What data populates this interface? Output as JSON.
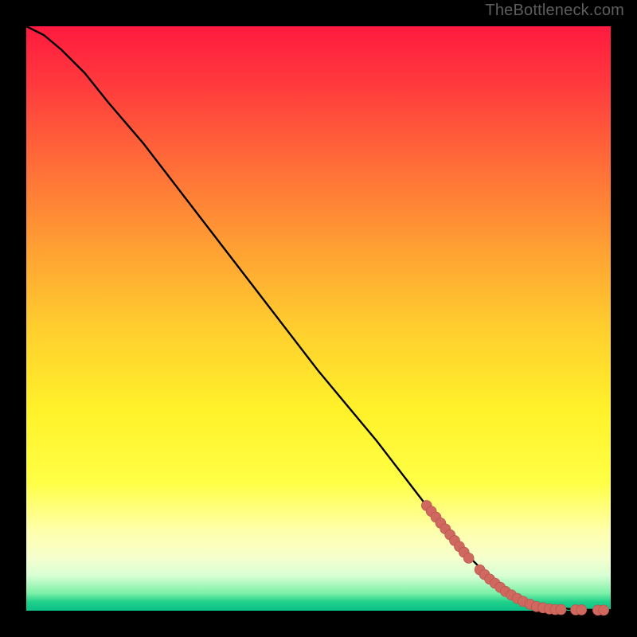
{
  "watermark": "TheBottleneck.com",
  "colors": {
    "background": "#000000",
    "watermark_text": "#5d5d5d",
    "curve_stroke": "#000000",
    "marker_fill": "#cf6960",
    "marker_stroke": "#b64f47"
  },
  "chart_data": {
    "type": "line",
    "title": "",
    "xlabel": "",
    "ylabel": "",
    "xlim": [
      0,
      100
    ],
    "ylim": [
      0,
      100
    ],
    "series": [
      {
        "name": "curve",
        "x": [
          0,
          3,
          6,
          10,
          14,
          20,
          30,
          40,
          50,
          60,
          70,
          76,
          80,
          83,
          85,
          87,
          90,
          94,
          100
        ],
        "y": [
          100,
          98.5,
          96,
          92,
          87,
          80,
          67,
          54,
          41,
          29,
          16,
          9,
          5,
          3,
          2,
          1.3,
          0.6,
          0.2,
          0.1
        ]
      }
    ],
    "markers": [
      {
        "x": 68.5,
        "y": 18.0
      },
      {
        "x": 69.3,
        "y": 17.0
      },
      {
        "x": 70.1,
        "y": 16.0
      },
      {
        "x": 70.9,
        "y": 15.0
      },
      {
        "x": 71.7,
        "y": 14.0
      },
      {
        "x": 72.5,
        "y": 13.0
      },
      {
        "x": 73.3,
        "y": 12.0
      },
      {
        "x": 74.1,
        "y": 11.0
      },
      {
        "x": 74.9,
        "y": 10.0
      },
      {
        "x": 75.7,
        "y": 9.0
      },
      {
        "x": 77.6,
        "y": 7.0
      },
      {
        "x": 78.4,
        "y": 6.2
      },
      {
        "x": 79.3,
        "y": 5.4
      },
      {
        "x": 80.2,
        "y": 4.7
      },
      {
        "x": 81.1,
        "y": 4.0
      },
      {
        "x": 82.0,
        "y": 3.3
      },
      {
        "x": 83.0,
        "y": 2.7
      },
      {
        "x": 84.0,
        "y": 2.1
      },
      {
        "x": 85.0,
        "y": 1.6
      },
      {
        "x": 86.2,
        "y": 1.1
      },
      {
        "x": 87.3,
        "y": 0.7
      },
      {
        "x": 88.4,
        "y": 0.5
      },
      {
        "x": 89.5,
        "y": 0.3
      },
      {
        "x": 90.5,
        "y": 0.2
      },
      {
        "x": 91.5,
        "y": 0.2
      },
      {
        "x": 94.0,
        "y": 0.15
      },
      {
        "x": 95.0,
        "y": 0.15
      },
      {
        "x": 97.8,
        "y": 0.1
      },
      {
        "x": 98.8,
        "y": 0.1
      }
    ],
    "marker_radius_px": 6.5
  }
}
